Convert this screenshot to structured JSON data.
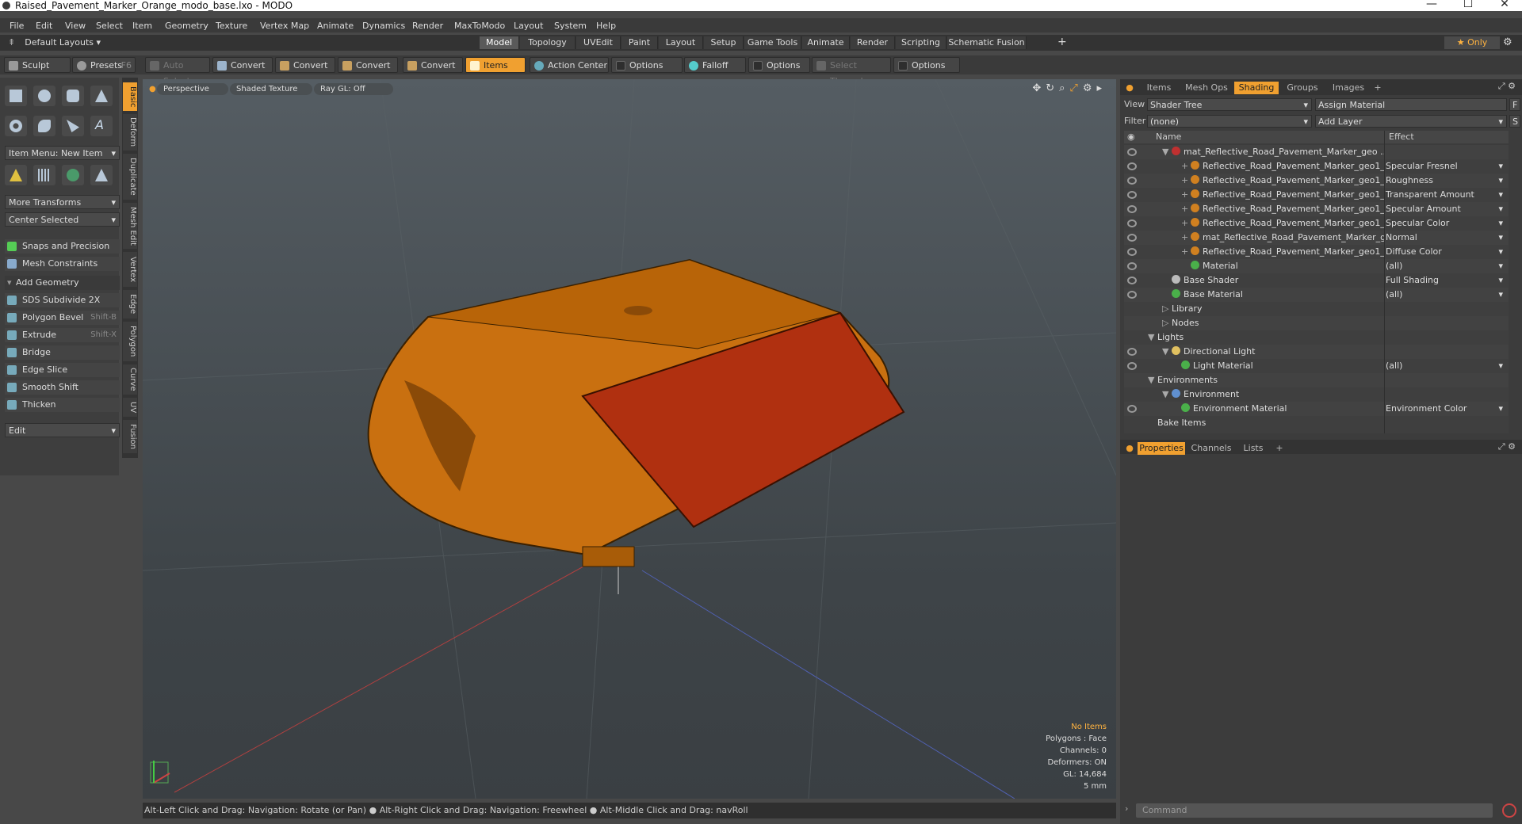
{
  "window": {
    "title": "Raised_Pavement_Marker_Orange_modo_base.lxo - MODO",
    "minimize": "—",
    "maximize": "☐",
    "close": "✕"
  },
  "menu": [
    "File",
    "Edit",
    "View",
    "Select",
    "Item",
    "Geometry",
    "Texture",
    "Vertex Map",
    "Animate",
    "Dynamics",
    "Render",
    "MaxToModo",
    "Layout",
    "System",
    "Help"
  ],
  "layouts": {
    "default": "Default Layouts ▾",
    "tabs": [
      "Model",
      "Topology",
      "UVEdit",
      "Paint",
      "Layout",
      "Setup",
      "Game Tools",
      "Animate",
      "Render",
      "Scripting",
      "Schematic Fusion"
    ],
    "active": "Model",
    "add": "+",
    "only": "★ Only"
  },
  "toolbar": {
    "sculpt": "Sculpt",
    "presets": "Presets",
    "presets_key": "F6",
    "auto_select": "Auto Select",
    "convert1": "Convert",
    "convert2": "Convert",
    "convert3": "Convert",
    "convert4": "Convert",
    "items": "Items",
    "action_center": "Action Center",
    "options1": "Options",
    "falloff": "Falloff",
    "options2": "Options",
    "select_through": "Select Through",
    "options3": "Options"
  },
  "left": {
    "item_menu": "Item Menu: New Item",
    "more_transforms": "More Transforms",
    "center_selected": "Center Selected",
    "snaps": "Snaps and Precision",
    "mesh_constraints": "Mesh Constraints",
    "add_geometry": "Add Geometry",
    "tools": [
      {
        "label": "SDS Subdivide 2X",
        "key": ""
      },
      {
        "label": "Polygon Bevel",
        "key": "Shift-B"
      },
      {
        "label": "Extrude",
        "key": "Shift-X"
      },
      {
        "label": "Bridge",
        "key": ""
      },
      {
        "label": "Edge Slice",
        "key": ""
      },
      {
        "label": "Smooth Shift",
        "key": ""
      },
      {
        "label": "Thicken",
        "key": ""
      }
    ],
    "edit": "Edit",
    "vtabs": [
      "Basic",
      "Deform",
      "Duplicate",
      "Mesh Edit",
      "Vertex",
      "Edge",
      "Polygon",
      "Curve",
      "UV",
      "Fusion"
    ]
  },
  "viewport": {
    "view": "Perspective",
    "shading": "Shaded Texture",
    "raygl": "Ray GL: Off",
    "no_items": "No Items",
    "polygons": "Polygons : Face",
    "channels": "Channels: 0",
    "deformers": "Deformers: ON",
    "gl": "GL: 14,684",
    "scale": "5 mm"
  },
  "status": "Alt-Left Click and Drag: Navigation: Rotate (or Pan) ● Alt-Right Click and Drag: Navigation: Freewheel ● Alt-Middle Click and Drag: navRoll",
  "right": {
    "tabs": [
      "Items",
      "Mesh Ops",
      "Shading",
      "Groups",
      "Images",
      "+"
    ],
    "active": "Shading",
    "view_label": "View",
    "view_value": "Shader Tree",
    "assign": "Assign Material",
    "f": "F",
    "filter_label": "Filter",
    "filter_value": "(none)",
    "add_layer": "Add Layer",
    "s": "S",
    "col_name": "Name",
    "col_effect": "Effect",
    "rows": [
      {
        "name": "mat_Reflective_Road_Pavement_Marker_geo ...",
        "effect": "",
        "indent": 60,
        "dot": "#c03030",
        "exp": "▼",
        "eye": true
      },
      {
        "name": "Reflective_Road_Pavement_Marker_geo1_ ...",
        "effect": "Specular Fresnel",
        "indent": 84,
        "dot": "#d08020",
        "exp": "+",
        "eye": true
      },
      {
        "name": "Reflective_Road_Pavement_Marker_geo1_ ...",
        "effect": "Roughness",
        "indent": 84,
        "dot": "#d08020",
        "exp": "+",
        "eye": true
      },
      {
        "name": "Reflective_Road_Pavement_Marker_geo1_ ...",
        "effect": "Transparent Amount",
        "indent": 84,
        "dot": "#d08020",
        "exp": "+",
        "eye": true
      },
      {
        "name": "Reflective_Road_Pavement_Marker_geo1_ ...",
        "effect": "Specular Amount",
        "indent": 84,
        "dot": "#d08020",
        "exp": "+",
        "eye": true
      },
      {
        "name": "Reflective_Road_Pavement_Marker_geo1_ ...",
        "effect": "Specular Color",
        "indent": 84,
        "dot": "#d08020",
        "exp": "+",
        "eye": true
      },
      {
        "name": "mat_Reflective_Road_Pavement_Marker_g ...",
        "effect": "Normal",
        "indent": 84,
        "dot": "#d08020",
        "exp": "+",
        "eye": true
      },
      {
        "name": "Reflective_Road_Pavement_Marker_geo1_ ...",
        "effect": "Diffuse Color",
        "indent": 84,
        "dot": "#d08020",
        "exp": "+",
        "eye": true
      },
      {
        "name": "Material",
        "effect": "(all)",
        "indent": 84,
        "dot": "#4ab04a",
        "exp": "",
        "eye": true
      },
      {
        "name": "Base Shader",
        "effect": "Full Shading",
        "indent": 60,
        "dot": "#bbbbbb",
        "exp": "",
        "eye": true
      },
      {
        "name": "Base Material",
        "effect": "(all)",
        "indent": 60,
        "dot": "#4ab04a",
        "exp": "",
        "eye": true
      },
      {
        "name": "Library",
        "effect": "",
        "indent": 60,
        "dot": "",
        "exp": "▷",
        "eye": false
      },
      {
        "name": "Nodes",
        "effect": "",
        "indent": 60,
        "dot": "",
        "exp": "▷",
        "eye": false
      },
      {
        "name": "Lights",
        "effect": "",
        "indent": 42,
        "dot": "",
        "exp": "▼",
        "eye": false
      },
      {
        "name": "Directional Light",
        "effect": "",
        "indent": 60,
        "dot": "#e0c060",
        "exp": "▼",
        "eye": true
      },
      {
        "name": "Light Material",
        "effect": "(all)",
        "indent": 72,
        "dot": "#4ab04a",
        "exp": "",
        "eye": true
      },
      {
        "name": "Environments",
        "effect": "",
        "indent": 42,
        "dot": "",
        "exp": "▼",
        "eye": false
      },
      {
        "name": "Environment",
        "effect": "",
        "indent": 60,
        "dot": "#6090d0",
        "exp": "▼",
        "eye": false
      },
      {
        "name": "Environment Material",
        "effect": "Environment Color",
        "indent": 72,
        "dot": "#4ab04a",
        "exp": "",
        "eye": true
      },
      {
        "name": "Bake Items",
        "effect": "",
        "indent": 42,
        "dot": "",
        "exp": "",
        "eye": false
      }
    ],
    "ptabs": [
      "Properties",
      "Channels",
      "Lists",
      "+"
    ],
    "command": "Command"
  }
}
